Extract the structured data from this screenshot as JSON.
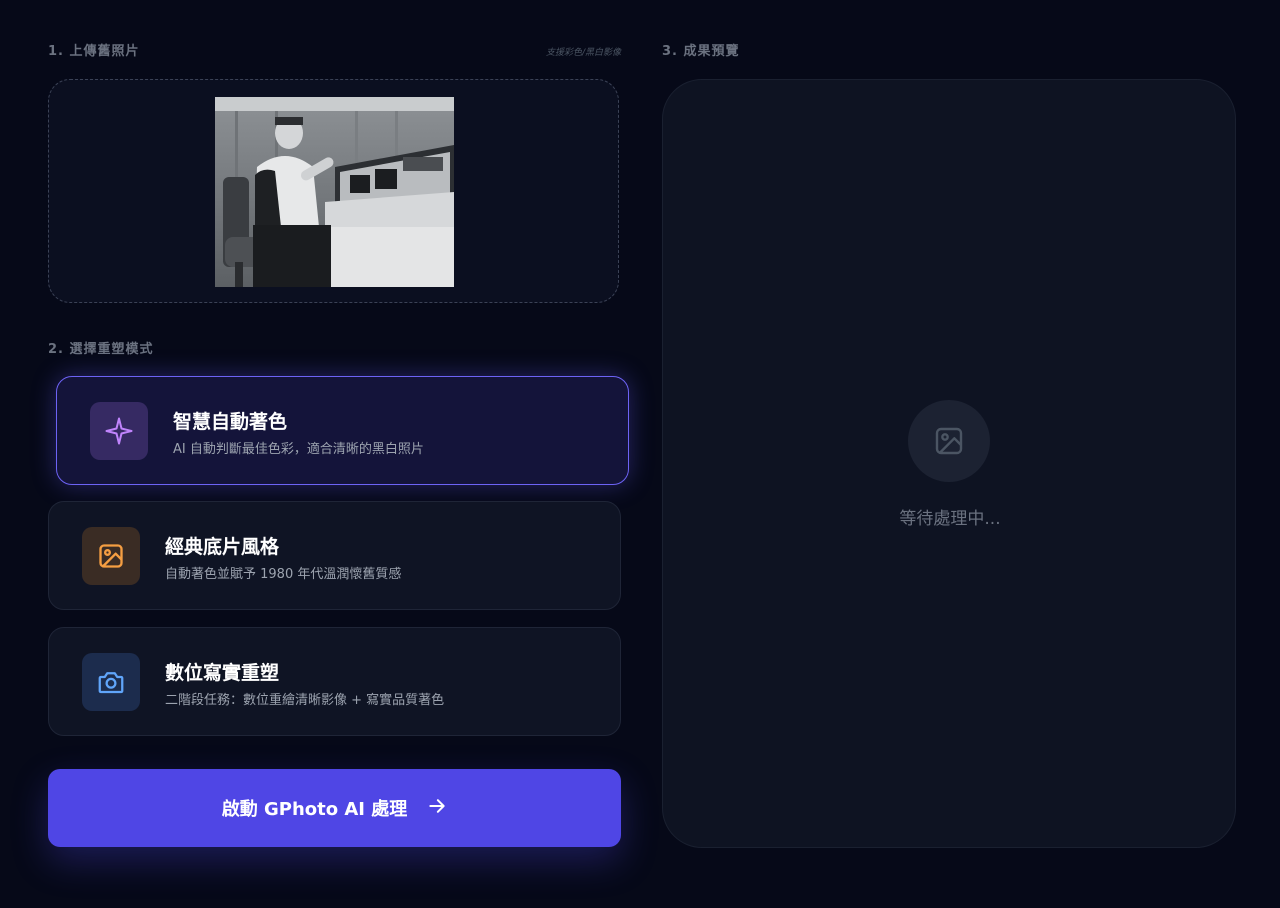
{
  "upload": {
    "title": "1. 上傳舊照片",
    "hint": "支援彩色/黑白影像"
  },
  "modes": {
    "title": "2. 選擇重塑模式",
    "items": [
      {
        "label": "智慧自動著色",
        "desc": "AI 自動判斷最佳色彩，適合清晰的黑白照片",
        "icon": "sparkle-icon",
        "accent": "#c084fc",
        "selected": true
      },
      {
        "label": "經典底片風格",
        "desc": "自動著色並賦予 1980 年代溫潤懷舊質感",
        "icon": "image-icon",
        "accent": "#f59e42",
        "selected": false
      },
      {
        "label": "數位寫實重塑",
        "desc": "二階段任務：數位重繪清晰影像 + 寫實品質著色",
        "icon": "camera-icon",
        "accent": "#60a5fa",
        "selected": false
      }
    ]
  },
  "action": {
    "label": "啟動 GPhoto AI 處理",
    "icon": "arrow-right-icon"
  },
  "preview": {
    "title": "3. 成果預覽",
    "status": "等待處理中...",
    "icon": "image-placeholder-icon"
  },
  "colors": {
    "background": "#060918",
    "accent": "#4f46e5",
    "active_border": "#6d63f5"
  }
}
